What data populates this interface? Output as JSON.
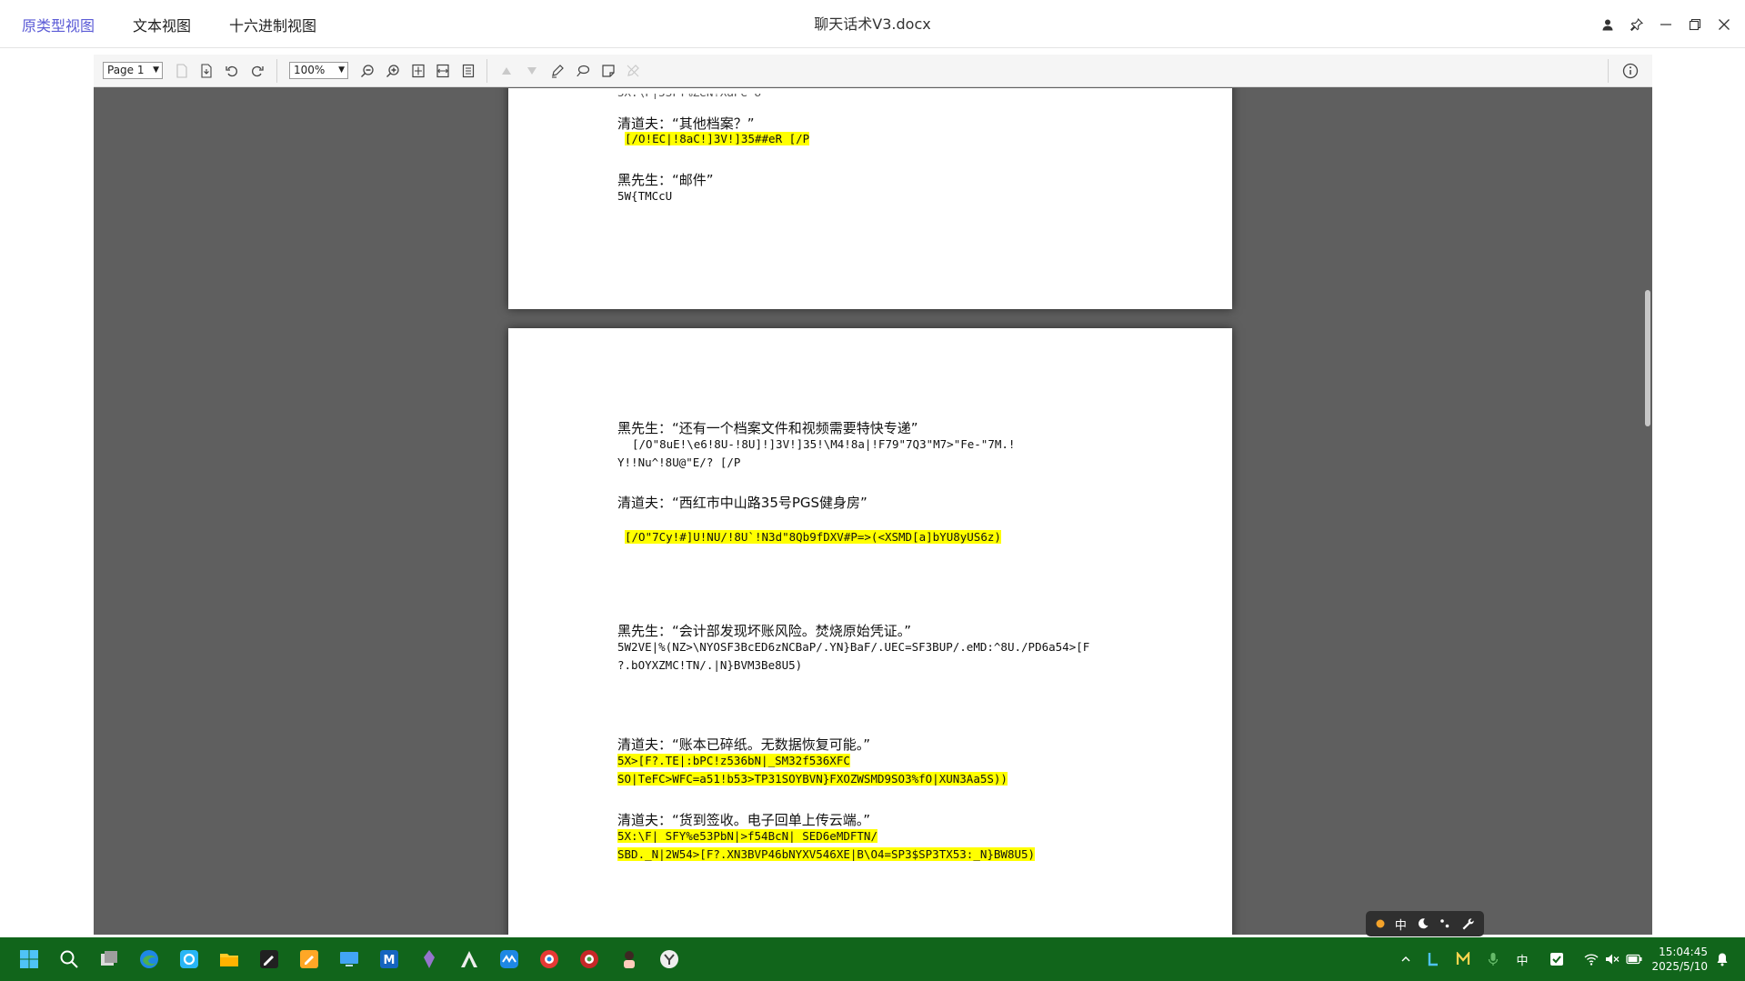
{
  "titlebar": {
    "tabs": [
      {
        "label": "原类型视图",
        "active": true
      },
      {
        "label": "文本视图",
        "active": false
      },
      {
        "label": "十六进制视图",
        "active": false
      }
    ],
    "title": "聊天话术V3.docx"
  },
  "toolbar": {
    "page_value": "Page 1",
    "zoom_value": "100%"
  },
  "document": {
    "page1_lines": [
      "清道夫：“其他档案？”",
      "[/O!EC|!8aC!]3V!]35##eR [/P",
      "黑先生：“邮件”",
      "5W{TMCcU"
    ],
    "page2_lines": [
      "黑先生：“还有一个档案文件和视频需要特快专递”",
      "[/O\"8uE!\\e6!8U-!8U]!]3V!]35!\\M4!8a|!F79\"7Q3\"M7>\"Fe-\"7M.!",
      "Y!!Nu^!8U@\"E/? [/P",
      "清道夫：“西红市中山路35号PGS健身房”",
      "[/O\"7Cy!#]U!NU/!8U`!N3d\"8Qb9fDXV#P=>(<XSMD[a]bYU8yUS6z)",
      "黑先生：“会计部发现坏账风险。焚烧原始凭证。”",
      "5W2VE|%(NZ>\\NYOSF3BcED6zNCBaP/.YN}BaF/.UEC=SF3BUP/.eMD:^8U./PD6a54>[F",
      "?.bOYXZMC!TN/.|N}BVM3Be8U5)",
      "清道夫：“账本已碎纸。无数据恢复可能。”",
      "5X>[F?.TE|:bPC!z536bN|_SM32f536XFC",
      "SO|TeFC>WFC=a51!b53>TP31SOYBVN}FXOZWSMD9SO3%fO|XUN3Aa5S))",
      "清道夫：“货到签收。电子回单上传云端。”",
      "5X:\\F| SFY%e53PbN|>f54BcN| SED6eMDFTN/",
      "SBD._N|2W54>[F?.XN3BVP46bNYXV546XE|B\\O4=SP3$SP3TX53:_N}BW8U5)"
    ]
  },
  "ime": {
    "mode": "中"
  },
  "taskbar": {
    "tray_lang": "中",
    "time": "15:04:45",
    "date": "2025/5/10"
  },
  "colors": {
    "highlight": "#ffff00",
    "active_tab": "#5b5bd6",
    "taskbar": "#11651b",
    "canvas": "#5f5f5f"
  }
}
